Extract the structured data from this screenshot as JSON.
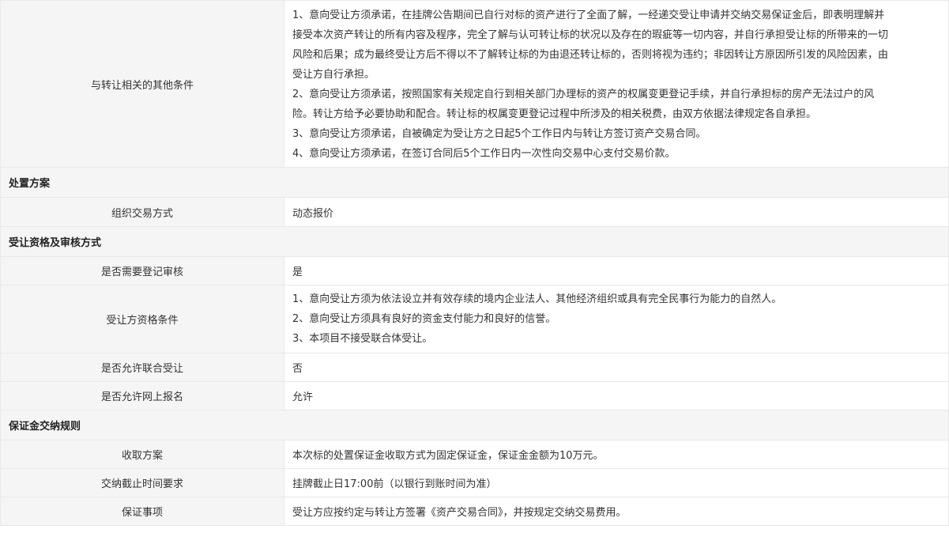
{
  "other_conditions": {
    "label": "与转让相关的其他条件",
    "lines": [
      "1、意向受让方须承诺，在挂牌公告期间已自行对标的资产进行了全面了解，一经递交受让申请并交纳交易保证金后，即表明理解并",
      "接受本次资产转让的所有内容及程序，完全了解与认可转让标的状况以及存在的瑕疵等一切内容，并自行承担受让标的所带来的一切",
      "风险和后果；成为最终受让方后不得以不了解转让标的为由退还转让标的，否则将视为违约；非因转让方原因所引发的风险因素，由",
      "受让方自行承担。",
      "2、意向受让方须承诺，按照国家有关规定自行到相关部门办理标的资产的权属变更登记手续，并自行承担标的房产无法过户的风",
      "险。转让方给予必要协助和配合。转让标的权属变更登记过程中所涉及的相关税费，由双方依据法律规定各自承担。",
      "3、意向受让方须承诺，自被确定为受让方之日起5个工作日内与转让方签订资产交易合同。",
      "4、意向受让方须承诺，在签订合同后5个工作日内一次性向交易中心支付交易价款。"
    ]
  },
  "disposal": {
    "section_title": "处置方案",
    "method_label": "组织交易方式",
    "method_value": "动态报价"
  },
  "qualification": {
    "section_title": "受让资格及审核方式",
    "registration_label": "是否需要登记审核",
    "registration_value": "是",
    "conditions_label": "受让方资格条件",
    "conditions_lines": [
      "1、意向受让方须为依法设立并有效存续的境内企业法人、其他经济组织或具有完全民事行为能力的自然人。",
      "2、意向受让方须具有良好的资金支付能力和良好的信誉。",
      "3、本项目不接受联合体受让。"
    ],
    "joint_label": "是否允许联合受让",
    "joint_value": "否",
    "online_label": "是否允许网上报名",
    "online_value": "允许"
  },
  "deposit": {
    "section_title": "保证金交纳规则",
    "plan_label": "收取方案",
    "plan_value": "本次标的处置保证金收取方式为固定保证金，保证金金额为10万元。",
    "deadline_label": "交纳截止时间要求",
    "deadline_value": "挂牌截止日17:00前（以银行到账时间为准）",
    "matters_label": "保证事项",
    "matters_value": "受让方应按约定与转让方签署《资产交易合同》，并按规定交纳交易费用。"
  }
}
